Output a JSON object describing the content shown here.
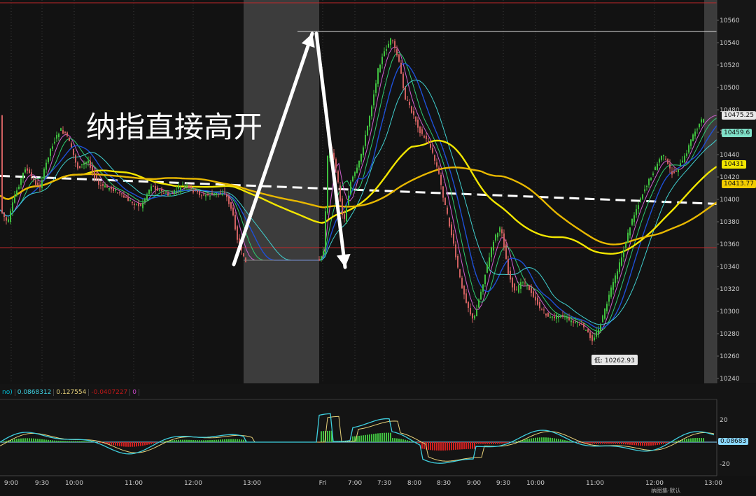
{
  "annotation": {
    "text": "纳指直接高开",
    "color": "#ffffff"
  },
  "main_chart": {
    "y_ticks": [
      10560,
      10540,
      10520,
      10500,
      10480,
      10460,
      10440,
      10420,
      10400,
      10380,
      10360,
      10340,
      10320,
      10300,
      10280,
      10260,
      10240
    ],
    "ylim": [
      10232,
      10572
    ],
    "price_chips": [
      {
        "name": "last-price-chip",
        "label": "10475.25",
        "value": 10475.25,
        "bg": "#e8e8e8",
        "fg": "#111111"
      },
      {
        "name": "ema-fast-chip",
        "label": "10459.6",
        "value": 10459.6,
        "bg": "#7fe0c8",
        "fg": "#111111"
      },
      {
        "name": "ema-yellow-chip",
        "label": "10431",
        "value": 10431,
        "bg": "#f2e600",
        "fg": "#111111"
      },
      {
        "name": "ema-yellow2-chip",
        "label": "10413.77",
        "value": 10413.77,
        "bg": "#f2cc00",
        "fg": "#111111"
      }
    ],
    "low_label": {
      "text": "低: 10262.93",
      "value": 10262.93
    },
    "resistance_levels": [
      10571,
      10354
    ],
    "high_line": 10550,
    "trendline": [
      10421,
      10396
    ]
  },
  "indicator_panel": {
    "header_values": [
      {
        "text": "no)",
        "color": "#00bcd4"
      },
      {
        "text": "0.0868312",
        "color": "#3fd0e0"
      },
      {
        "text": "0.127554",
        "color": "#e8d27a"
      },
      {
        "text": "-0.0407227",
        "color": "#c01818"
      },
      {
        "text": "0",
        "color": "#d04ad0"
      }
    ],
    "y_ticks": [
      "20",
      "-20"
    ],
    "value_chip": "0.08683",
    "zero_color": "#8ad8ff"
  },
  "x_axis": {
    "labels": [
      "9:00",
      "9:30",
      "10:00",
      "11:00",
      "12:00",
      "13:00",
      "Fri",
      "7:00",
      "7:30",
      "8:00",
      "8:30",
      "9:00",
      "9:30",
      "10:00",
      "11:00",
      "12:00",
      "13:00"
    ]
  },
  "footer_text": "纳图集·默认",
  "chart_data": {
    "type": "candlestick",
    "title": "",
    "xlabel": "",
    "ylabel": "",
    "ylim": [
      10232,
      10572
    ],
    "x": [
      "9:00",
      "9:30",
      "10:00",
      "11:00",
      "12:00",
      "13:00",
      "Fri",
      "7:00",
      "7:30",
      "8:00",
      "8:30",
      "9:00",
      "9:30",
      "10:00",
      "11:00",
      "12:00",
      "13:00"
    ],
    "price_path": [
      {
        "x": "9:00",
        "y": 10390
      },
      {
        "x": "9:30",
        "y": 10420
      },
      {
        "x": "10:00",
        "y": 10440
      },
      {
        "x": "11:00",
        "y": 10400
      },
      {
        "x": "12:00",
        "y": 10405
      },
      {
        "x": "13:00",
        "y": 10346
      },
      {
        "x": "Fri",
        "y": 10440
      },
      {
        "x": "7:00",
        "y": 10460
      },
      {
        "x": "7:30",
        "y": 10530
      },
      {
        "x": "8:00",
        "y": 10475
      },
      {
        "x": "8:30",
        "y": 10330
      },
      {
        "x": "9:00",
        "y": 10310
      },
      {
        "x": "9:30",
        "y": 10330
      },
      {
        "x": "10:00",
        "y": 10300
      },
      {
        "x": "11:00",
        "y": 10275
      },
      {
        "x": "12:00",
        "y": 10420
      },
      {
        "x": "13:00",
        "y": 10475.25
      }
    ],
    "high": 10552,
    "low": 10262.93,
    "last": 10475.25,
    "series": [
      {
        "name": "",
        "values": [
          10459.6
        ],
        "color": "#7fe0c8"
      },
      {
        "name": "",
        "values": [
          10431
        ],
        "color": "#f2e600"
      },
      {
        "name": "",
        "values": [
          10413.77
        ],
        "color": "#f2cc00"
      }
    ],
    "grid": false
  }
}
